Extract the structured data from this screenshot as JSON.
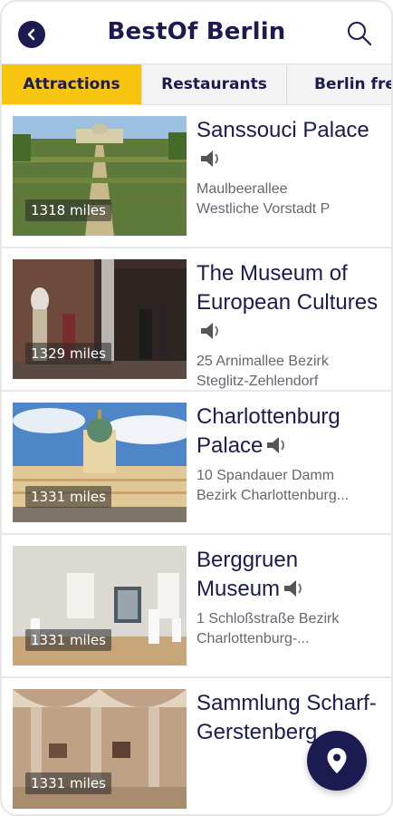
{
  "header": {
    "title": "BestOf Berlin",
    "back_icon": "back-arrow-icon",
    "search_icon": "search-icon"
  },
  "tabs": [
    {
      "label": "Attractions",
      "active": true
    },
    {
      "label": "Restaurants",
      "active": false
    },
    {
      "label": "Berlin free",
      "active": false
    }
  ],
  "places": [
    {
      "name": "Sanssouci Palace",
      "distance": "1318 miles",
      "address_line1": "Maulbeerallee",
      "address_line2": "Westliche Vorstadt P",
      "audio_icon": "speaker-icon"
    },
    {
      "name": "The Museum of European Cultures",
      "distance": "1329 miles",
      "address_line1": "25 Arnimallee Bezirk",
      "address_line2": "Steglitz-Zehlendorf",
      "audio_icon": "speaker-icon"
    },
    {
      "name": "Charlottenburg Palace",
      "distance": "1331 miles",
      "address_line1": "10 Spandauer Damm",
      "address_line2": "Bezirk Charlottenburg...",
      "audio_icon": "speaker-icon"
    },
    {
      "name": "Berggruen Museum",
      "distance": "1331 miles",
      "address_line1": "1 Schloßstraße Bezirk",
      "address_line2": "Charlottenburg-...",
      "audio_icon": "speaker-icon"
    },
    {
      "name": "Sammlung Scharf-Gerstenberg...",
      "distance": "1331 miles",
      "address_line1": "",
      "address_line2": "",
      "audio_icon": "speaker-icon"
    }
  ],
  "fab": {
    "icon": "map-pin-icon"
  },
  "colors": {
    "primary": "#1b1b52",
    "accent": "#f7c40f",
    "tabs_bg": "#f3f3f4"
  }
}
